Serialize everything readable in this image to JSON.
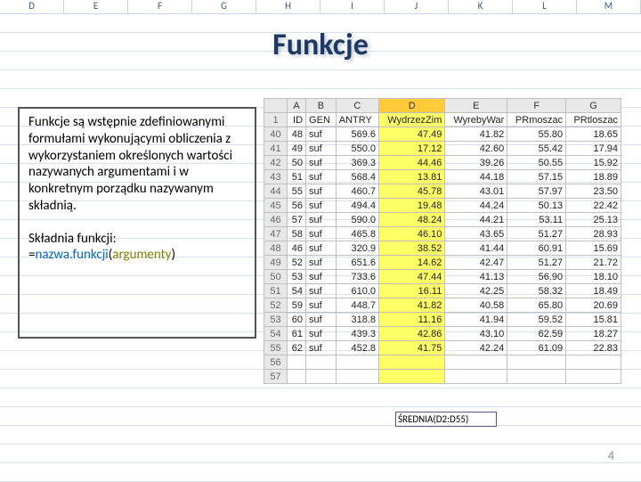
{
  "bg_cols": [
    "D",
    "E",
    "F",
    "G",
    "H",
    "I",
    "J",
    "K",
    "L",
    "M"
  ],
  "title": "Funkcje",
  "box": {
    "para": "Funkcje są wstępnie zdefiniowanymi formułami wykonującymi obliczenia z wykorzystaniem określonych wartości nazywanych argumentami i w konkretnym porządku nazywanym składnią.",
    "syntax_label": "Składnia funkcji:",
    "eq": "=",
    "nf": "nazwa.funkcji",
    "par_open": "(",
    "arg": "argumenty",
    "par_close": ")"
  },
  "chart_data": {
    "type": "table",
    "columns": [
      "",
      "A",
      "B",
      "C",
      "D",
      "E",
      "F",
      "G"
    ],
    "header_row": [
      "1",
      "ID",
      "GEN",
      "ANTRY",
      "WydrzezZim",
      "WyrebyWar",
      "PRmoszac",
      "PRtloszac"
    ],
    "rows": [
      [
        "40",
        "48",
        "suf",
        "569.6",
        "47.49",
        "41.82",
        "55.80",
        "18.65"
      ],
      [
        "41",
        "49",
        "suf",
        "550.0",
        "17.12",
        "42.60",
        "55.42",
        "17.94"
      ],
      [
        "42",
        "50",
        "suf",
        "369.3",
        "44.46",
        "39.26",
        "50.55",
        "15.92"
      ],
      [
        "43",
        "51",
        "suf",
        "568.4",
        "13.81",
        "44.18",
        "57.15",
        "18.89"
      ],
      [
        "44",
        "55",
        "suf",
        "460.7",
        "45.78",
        "43.01",
        "57.97",
        "23.50"
      ],
      [
        "45",
        "56",
        "suf",
        "494.4",
        "19.48",
        "44.24",
        "50.13",
        "22.42"
      ],
      [
        "46",
        "57",
        "suf",
        "590.0",
        "48.24",
        "44.21",
        "53.11",
        "25.13"
      ],
      [
        "47",
        "58",
        "suf",
        "465.8",
        "46.10",
        "43.65",
        "51.27",
        "28.93"
      ],
      [
        "48",
        "46",
        "suf",
        "320.9",
        "38.52",
        "41.44",
        "60.91",
        "15.69"
      ],
      [
        "49",
        "52",
        "suf",
        "651.6",
        "14.62",
        "42.47",
        "51.27",
        "21.72"
      ],
      [
        "50",
        "53",
        "suf",
        "733.6",
        "47.44",
        "41.13",
        "56.90",
        "18.10"
      ],
      [
        "51",
        "54",
        "suf",
        "610.0",
        "16.11",
        "42.25",
        "58.32",
        "18.49"
      ],
      [
        "52",
        "59",
        "suf",
        "448.7",
        "41.82",
        "40.58",
        "65.80",
        "20.69"
      ],
      [
        "53",
        "60",
        "suf",
        "318.8",
        "11.16",
        "41.94",
        "59.52",
        "15.81"
      ],
      [
        "54",
        "61",
        "suf",
        "439.3",
        "42.86",
        "43.10",
        "62.59",
        "18.27"
      ],
      [
        "55",
        "62",
        "suf",
        "452.8",
        "41.75",
        "42.24",
        "61.09",
        "22.83"
      ],
      [
        "56",
        "",
        "",
        "",
        "",
        "",
        "",
        ""
      ],
      [
        "57",
        "",
        "",
        "",
        "",
        "",
        "",
        ""
      ]
    ]
  },
  "formula": "ŚREDNIA(D2:D55)",
  "slidenum": "4"
}
